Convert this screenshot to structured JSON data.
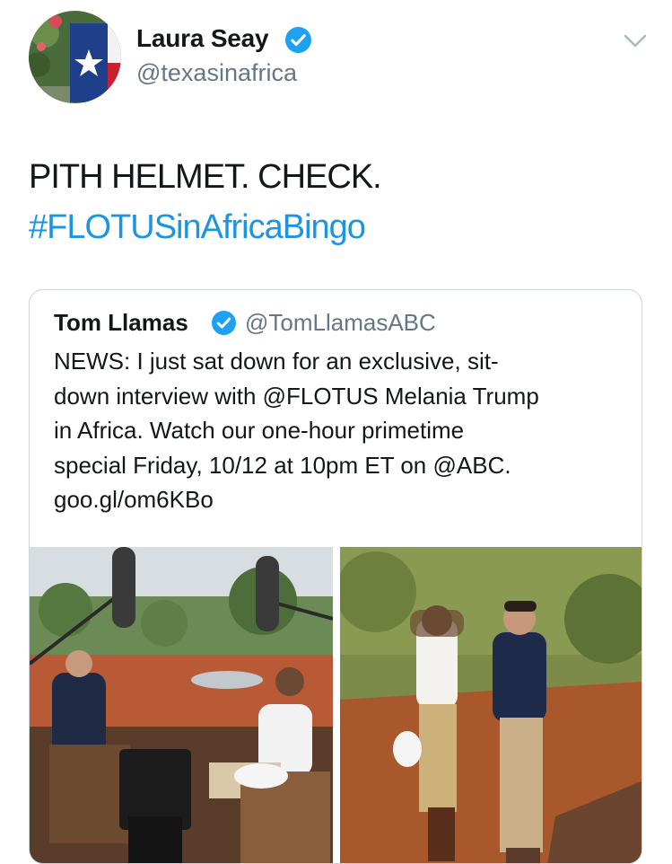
{
  "author": {
    "name": "Laura Seay",
    "handle": "@texasinafrica",
    "verified": true
  },
  "menu": {
    "icon": "chevron-down-icon"
  },
  "tweet": {
    "line1": "PITH HELMET. CHECK.",
    "hashtag": "#FLOTUSinAfricaBingo"
  },
  "quoted_tweet": {
    "name": "Tom Llamas",
    "handle": "@TomLlamasABC",
    "verified": true,
    "text_lines": [
      "NEWS: I just sat down for an exclusive, sit-",
      "down interview with @FLOTUS Melania Trump",
      "in Africa. Watch our one-hour primetime",
      "special Friday, 10/12 at 10pm ET on @ABC.",
      "goo.gl/om6KBo"
    ]
  },
  "colors": {
    "link": "#1b95e0",
    "verified": "#1da1f2",
    "secondary_text": "#657786",
    "border": "#ccd6dd"
  }
}
